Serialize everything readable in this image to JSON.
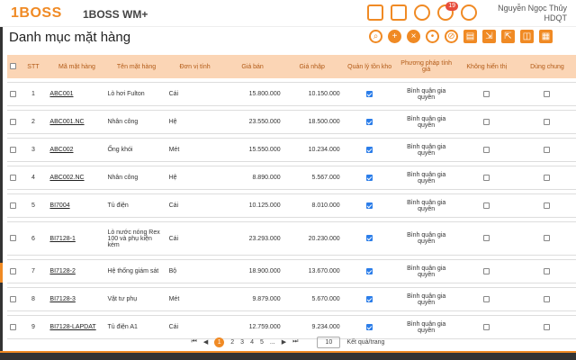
{
  "header": {
    "logo": "1BOSS",
    "app_name": "1BOSS WM+",
    "notification_count": "19",
    "user_name": "Nguyễn Ngọc Thủy",
    "user_role": "HDQT"
  },
  "page": {
    "title": "Danh mục mặt hàng"
  },
  "table": {
    "columns": {
      "stt": "STT",
      "code": "Mã mặt hàng",
      "name": "Tên mặt hàng",
      "unit": "Đơn vị tính",
      "sell": "Giá bán",
      "buy": "Giá nhập",
      "inventory": "Quản lý tồn kho",
      "method": "Phương pháp tính giá",
      "hidden": "Không hiển thị",
      "shared": "Dùng chung"
    },
    "rows": [
      {
        "stt": "1",
        "code": "ABC001",
        "name": "Lò hơi Fulton",
        "unit": "Cái",
        "sell": "15.800.000",
        "buy": "10.150.000",
        "method": "Bình quân gia quyền"
      },
      {
        "stt": "2",
        "code": "ABC001.NC",
        "name": "Nhân công",
        "unit": "Hệ",
        "sell": "23.550.000",
        "buy": "18.500.000",
        "method": "Bình quân gia quyền"
      },
      {
        "stt": "3",
        "code": "ABC002",
        "name": "Ống khói",
        "unit": "Mét",
        "sell": "15.550.000",
        "buy": "10.234.000",
        "method": "Bình quân gia quyền"
      },
      {
        "stt": "4",
        "code": "ABC002.NC",
        "name": "Nhân công",
        "unit": "Hệ",
        "sell": "8.890.000",
        "buy": "5.567.000",
        "method": "Bình quân gia quyền"
      },
      {
        "stt": "5",
        "code": "BI7004",
        "name": "Tủ điện",
        "unit": "Cái",
        "sell": "10.125.000",
        "buy": "8.010.000",
        "method": "Bình quân gia quyền"
      },
      {
        "stt": "6",
        "code": "BI7128-1",
        "name": "Lò nước nóng Rex 100 và phụ kiện kèm",
        "unit": "Cái",
        "sell": "23.293.000",
        "buy": "20.230.000",
        "method": "Bình quân gia quyền"
      },
      {
        "stt": "7",
        "code": "BI7128-2",
        "name": "Hệ thống giám sát",
        "unit": "Bộ",
        "sell": "18.900.000",
        "buy": "13.670.000",
        "method": "Bình quân gia quyền"
      },
      {
        "stt": "8",
        "code": "BI7128-3",
        "name": "Vật tư phụ",
        "unit": "Mét",
        "sell": "9.879.000",
        "buy": "5.670.000",
        "method": "Bình quân gia quyền"
      },
      {
        "stt": "9",
        "code": "BI7128-LAPDAT",
        "name": "Tủ điện A1",
        "unit": "Cái",
        "sell": "12.759.000",
        "buy": "9.234.000",
        "method": "Bình quân gia quyền"
      }
    ]
  },
  "pager": {
    "first": "⏮",
    "prev": "◀",
    "pages": [
      "1",
      "2",
      "3",
      "4",
      "5"
    ],
    "ellipsis": "...",
    "next": "▶",
    "last": "⏭",
    "page_size": "10",
    "per_page_label": "Kết quả/trang"
  },
  "colors": {
    "accent": "#f08a24",
    "header_bg": "#fbd5b5"
  }
}
